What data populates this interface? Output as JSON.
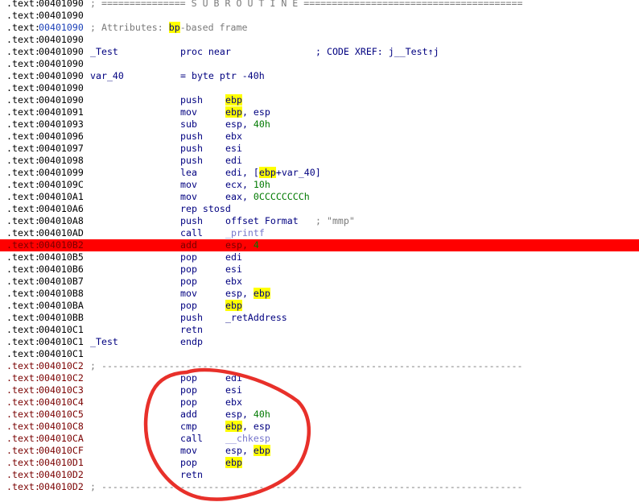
{
  "segment": ".text",
  "highlighted_register": "ebp",
  "lines": [
    {
      "addr": "00401090",
      "kind": "separator",
      "text": "; =============== S U B R O U T I N E ======================================="
    },
    {
      "addr": "00401090",
      "kind": "blank"
    },
    {
      "addr": "00401090",
      "kind": "attr",
      "addr_style": "blue",
      "pre": "; Attributes: ",
      "reg": "bp",
      "post": "-based frame"
    },
    {
      "addr": "00401090",
      "kind": "blank"
    },
    {
      "addr": "00401090",
      "kind": "proc",
      "label": "_Test",
      "mnemonic": "proc near",
      "xref": "; CODE XREF: j__Test↑j"
    },
    {
      "addr": "00401090",
      "kind": "blank"
    },
    {
      "addr": "00401090",
      "kind": "var",
      "label": "var_40",
      "mnemonic": "= byte ptr -40h"
    },
    {
      "addr": "00401090",
      "kind": "blank"
    },
    {
      "addr": "00401090",
      "kind": "ins",
      "mnemonic": "push",
      "ops": [
        {
          "t": "ebp",
          "c": "hi"
        }
      ]
    },
    {
      "addr": "00401091",
      "kind": "ins",
      "mnemonic": "mov",
      "ops": [
        {
          "t": "ebp",
          "c": "hi"
        },
        {
          "t": ", esp"
        }
      ]
    },
    {
      "addr": "00401093",
      "kind": "ins",
      "mnemonic": "sub",
      "ops": [
        {
          "t": "esp, "
        },
        {
          "t": "40h",
          "c": "num"
        }
      ]
    },
    {
      "addr": "00401096",
      "kind": "ins",
      "mnemonic": "push",
      "ops": [
        {
          "t": "ebx"
        }
      ]
    },
    {
      "addr": "00401097",
      "kind": "ins",
      "mnemonic": "push",
      "ops": [
        {
          "t": "esi"
        }
      ]
    },
    {
      "addr": "00401098",
      "kind": "ins",
      "mnemonic": "push",
      "ops": [
        {
          "t": "edi"
        }
      ]
    },
    {
      "addr": "00401099",
      "kind": "ins",
      "mnemonic": "lea",
      "ops": [
        {
          "t": "edi, ["
        },
        {
          "t": "ebp",
          "c": "hi"
        },
        {
          "t": "+var_40]"
        }
      ]
    },
    {
      "addr": "0040109C",
      "kind": "ins",
      "mnemonic": "mov",
      "ops": [
        {
          "t": "ecx, "
        },
        {
          "t": "10h",
          "c": "num"
        }
      ]
    },
    {
      "addr": "004010A1",
      "kind": "ins",
      "mnemonic": "mov",
      "ops": [
        {
          "t": "eax, "
        },
        {
          "t": "0CCCCCCCCh",
          "c": "num"
        }
      ]
    },
    {
      "addr": "004010A6",
      "kind": "ins",
      "mnemonic": "rep stosd",
      "ops": []
    },
    {
      "addr": "004010A8",
      "kind": "ins",
      "mnemonic": "push",
      "ops": [
        {
          "t": "offset Format"
        }
      ],
      "comment": "; \"mmp\""
    },
    {
      "addr": "004010AD",
      "kind": "ins",
      "mnemonic": "call",
      "ops": [
        {
          "t": "_printf",
          "c": "ext"
        }
      ]
    },
    {
      "addr": "004010B2",
      "kind": "ins",
      "highlight": true,
      "mnemonic": "add",
      "ops": [
        {
          "t": "esp, "
        },
        {
          "t": "4",
          "c": "num"
        }
      ]
    },
    {
      "addr": "004010B5",
      "kind": "ins",
      "mnemonic": "pop",
      "ops": [
        {
          "t": "edi"
        }
      ]
    },
    {
      "addr": "004010B6",
      "kind": "ins",
      "mnemonic": "pop",
      "ops": [
        {
          "t": "esi"
        }
      ]
    },
    {
      "addr": "004010B7",
      "kind": "ins",
      "mnemonic": "pop",
      "ops": [
        {
          "t": "ebx"
        }
      ]
    },
    {
      "addr": "004010B8",
      "kind": "ins",
      "mnemonic": "mov",
      "ops": [
        {
          "t": "esp, "
        },
        {
          "t": "ebp",
          "c": "hi"
        }
      ]
    },
    {
      "addr": "004010BA",
      "kind": "ins",
      "mnemonic": "pop",
      "ops": [
        {
          "t": "ebp",
          "c": "hi"
        }
      ]
    },
    {
      "addr": "004010BB",
      "kind": "ins",
      "mnemonic": "push",
      "ops": [
        {
          "t": "_retAddress"
        }
      ]
    },
    {
      "addr": "004010C1",
      "kind": "ins",
      "mnemonic": "retn",
      "ops": []
    },
    {
      "addr": "004010C1",
      "kind": "proc",
      "label": "_Test",
      "mnemonic": "endp"
    },
    {
      "addr": "004010C1",
      "kind": "blank"
    },
    {
      "addr": "004010C2",
      "kind": "separator",
      "addr_style": "dark",
      "text": "; ---------------------------------------------------------------------------"
    },
    {
      "addr": "004010C2",
      "kind": "ins",
      "addr_style": "dark",
      "mnemonic": "pop",
      "ops": [
        {
          "t": "edi"
        }
      ]
    },
    {
      "addr": "004010C3",
      "kind": "ins",
      "addr_style": "dark",
      "mnemonic": "pop",
      "ops": [
        {
          "t": "esi"
        }
      ]
    },
    {
      "addr": "004010C4",
      "kind": "ins",
      "addr_style": "dark",
      "mnemonic": "pop",
      "ops": [
        {
          "t": "ebx"
        }
      ]
    },
    {
      "addr": "004010C5",
      "kind": "ins",
      "addr_style": "dark",
      "mnemonic": "add",
      "ops": [
        {
          "t": "esp, "
        },
        {
          "t": "40h",
          "c": "num"
        }
      ]
    },
    {
      "addr": "004010C8",
      "kind": "ins",
      "addr_style": "dark",
      "mnemonic": "cmp",
      "ops": [
        {
          "t": "ebp",
          "c": "hi"
        },
        {
          "t": ", esp"
        }
      ]
    },
    {
      "addr": "004010CA",
      "kind": "ins",
      "addr_style": "dark",
      "mnemonic": "call",
      "ops": [
        {
          "t": "__chkesp",
          "c": "ext"
        }
      ]
    },
    {
      "addr": "004010CF",
      "kind": "ins",
      "addr_style": "dark",
      "mnemonic": "mov",
      "ops": [
        {
          "t": "esp, "
        },
        {
          "t": "ebp",
          "c": "hi"
        }
      ]
    },
    {
      "addr": "004010D1",
      "kind": "ins",
      "addr_style": "dark",
      "mnemonic": "pop",
      "ops": [
        {
          "t": "ebp",
          "c": "hi"
        }
      ]
    },
    {
      "addr": "004010D2",
      "kind": "ins",
      "addr_style": "dark",
      "mnemonic": "retn",
      "ops": []
    },
    {
      "addr": "004010D2",
      "kind": "separator",
      "addr_style": "dark",
      "text": "; ---------------------------------------------------------------------------"
    }
  ],
  "colors": {
    "line_highlight": "#ff0000",
    "register_highlight": "#ffff00",
    "annotation_circle": "#e8302a"
  }
}
